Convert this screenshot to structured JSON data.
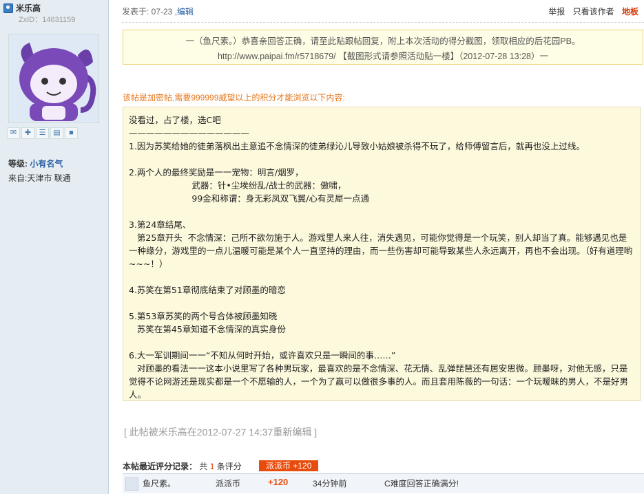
{
  "user": {
    "name": "米乐高",
    "zxid": "ZxID：14631159",
    "level_label": "等级:",
    "level_value": "小有名气",
    "from": "来自:天津市  联通"
  },
  "post": {
    "posted_prefix": "发表于: 07-23",
    "edit_link": ",编辑",
    "report": "举报",
    "only_author": "只看该作者",
    "floor": "地板"
  },
  "notice": "一（鱼尺素。）恭喜亲回答正确，请至此贴跟帖回复，附上本次活动的得分截图，领取相应的后花园PB。http://www.paipai.fm/r5718679/ 【截图形式请参照活动贴一楼】（2012-07-28 13:28）一",
  "encrypt_notice": "该帖是加密帖,需要999999威望以上的积分才能浏览以下内容:",
  "content": {
    "lines": [
      "没看过，占了楼，选C吧",
      "——————————————",
      "1.因为苏笑给她的徒弟落枫出主意追不念情深的徒弟绿沁儿导致小姑娘被杀得不玩了，给师傅留言后，就再也没上过线。",
      "",
      "2.两个人的最终奖励是一一宠物：明言/烟罗，",
      "                       武器：针•尘埃纷乱/战士的武器：傲啸，",
      "                       99金和称谓：身无彩凤双飞翼/心有灵犀一点通",
      "",
      "3.第24章结尾、",
      "   第25章开头  不念情深：己所不欲勿施于人。游戏里人来人往，消失遇见，可能你觉得是一个玩笑，别人却当了真。能够遇见也是一种缘分，游戏里的一点儿温暖可能是某个人一直坚持的理由，而一些伤害却可能导致某些人永远离开，再也不会出现。（好有道理哟~~~！）",
      "",
      "4.苏笑在第51章彻底结束了对顾墨的暗恋",
      "",
      "5.第53章苏笑的两个号合体被顾墨知晓",
      "   苏笑在第45章知道不念情深的真实身份",
      "",
      "6.大一军训期间一一“不知从何时开始，或许喜欢只是一瞬间的事……”",
      "   对顾墨的看法一一这本小说里写了各种男玩家，最喜欢的是不念情深、花无情、乱弹琵琶还有居安思微。顾墨呀，对他无感，只是觉得不论网游还是现实都是一个不愿输的人，一个为了赢可以做很多事的人。而且套用陈薇的一句话：一个玩暧昧的男人，不是好男人。"
    ]
  },
  "edit_note": "[ 此帖被米乐高在2012-07-27 14:37重新编辑 ]",
  "rating": {
    "title_label": "本帖最近评分记录：",
    "count_text_1": "共",
    "count": "1",
    "count_text_2": "条评分",
    "badge": "派派币  +120",
    "row": {
      "name": "鱼尺素。",
      "currency": "派派币",
      "points": "+120",
      "time": "34分钟前",
      "reason": "C难度回答正确满分!"
    }
  },
  "icons": [
    "message-icon",
    "add-friend-icon",
    "profile-icon",
    "card-icon",
    "blocks-icon"
  ]
}
